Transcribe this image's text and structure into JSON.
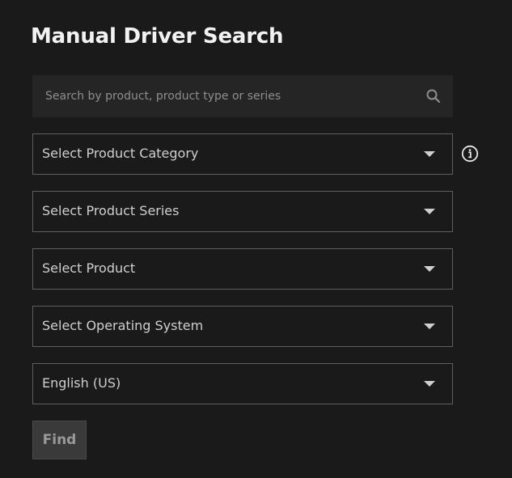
{
  "page": {
    "title": "Manual Driver Search"
  },
  "search": {
    "placeholder": "Search by product, product type or series",
    "icon": "search-icon"
  },
  "dropdowns": {
    "category": {
      "label": "Select Product Category"
    },
    "series": {
      "label": "Select Product Series"
    },
    "product": {
      "label": "Select Product"
    },
    "os": {
      "label": "Select Operating System"
    },
    "language": {
      "label": "English (US)"
    }
  },
  "info": {
    "icon": "info-icon"
  },
  "actions": {
    "find_label": "Find"
  },
  "colors": {
    "background": "#1a1a1a",
    "search_background": "#252525",
    "border": "#5e5e5e",
    "button_background": "#3a3a3a",
    "button_text": "#9a9a9a",
    "text": "#cfcfcf"
  }
}
